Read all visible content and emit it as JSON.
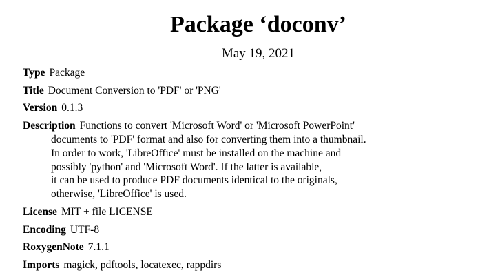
{
  "header": {
    "title": "Package ‘doconv’",
    "date": "May 19, 2021"
  },
  "fields": {
    "type": {
      "key": "Type",
      "value": "Package"
    },
    "title": {
      "key": "Title",
      "value": "Document Conversion to 'PDF' or 'PNG'"
    },
    "version": {
      "key": "Version",
      "value": "0.1.3"
    },
    "description": {
      "key": "Description",
      "first_line": "Functions to convert 'Microsoft Word' or 'Microsoft PowerPoint'",
      "lines": [
        "documents to 'PDF' format and also for converting them into a thumbnail.",
        "In order to work, 'LibreOffice' must be installed on the machine and",
        "possibly 'python' and 'Microsoft Word'. If the latter is available,",
        "it can be used to produce PDF documents identical to the originals,",
        "otherwise, 'LibreOffice' is used."
      ]
    },
    "license": {
      "key": "License",
      "value": "MIT + file LICENSE"
    },
    "encoding": {
      "key": "Encoding",
      "value": "UTF-8"
    },
    "roxygen": {
      "key": "RoxygenNote",
      "value": "7.1.1"
    },
    "imports": {
      "key": "Imports",
      "value": "magick, pdftools, locatexec, rappdirs"
    }
  }
}
